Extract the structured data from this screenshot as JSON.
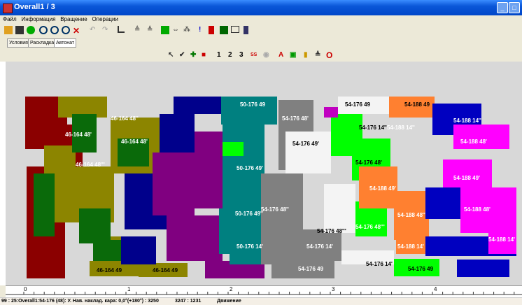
{
  "window": {
    "title": "Overall1 / 3",
    "minimize_glyph": "_",
    "maximize_glyph": "□"
  },
  "menu": {
    "items": [
      "Файл",
      "Информация",
      "Вращение",
      "Операции"
    ]
  },
  "tabs": [
    {
      "label": "Условия"
    },
    {
      "label": "Раскладка"
    },
    {
      "label": "Автонат"
    }
  ],
  "toolbar2": {
    "digits": [
      "1",
      "2",
      "3"
    ],
    "ss_label": "SS",
    "zero_label": "O"
  },
  "labels": {
    "p1": "46-164 48'",
    "p2": "46-164 48''",
    "p3": "46-164 48'",
    "p4": "46-164 48'''",
    "p5": "50-176 49",
    "p6": "50-176 49'",
    "p7": "50-176 49''",
    "p8": "50-176 14'",
    "p9": "54-176 48'",
    "p10": "54-176 49'",
    "p11": "54-176 49",
    "p12": "54-176 14''",
    "p13": "54-176 48''",
    "p14": "54-176 48'''",
    "p15": "54-176 14'",
    "p16": "54-176 49",
    "p17": "54-176 14'",
    "p18": "54-176 48'",
    "p19": "54-188 49",
    "p20": "54-188 14''",
    "p21": "54-188 48'",
    "p22": "54-188 49'",
    "p23": "54-188 14'",
    "p24": "54-188 48''",
    "p25": "54-188 14'",
    "p26": "54-188 49'",
    "p27": "54-188 48'",
    "p28": "54-188 14''",
    "p29": "54-176 49",
    "p30": "46-164 49",
    "p31": "46-164 49",
    "p32": "54-176 48'''"
  },
  "ruler": {
    "bottom_marks": [
      "0",
      "1",
      "2",
      "3",
      "4"
    ]
  },
  "status": {
    "left": "99 : 25:Overall1:54-176 (48): У. Нав. наклад. кара: 0,0°(+180°) : 3250",
    "coords": "3247 : 1231",
    "mode": "Движение"
  },
  "colors": {
    "titlebar": "#0a56d8",
    "canvas": "#d8d8d8",
    "dark_red": "#8b0000",
    "olive": "#8c8500",
    "blue": "#00008b",
    "purple": "#800080",
    "teal": "#008080",
    "grey": "#808080",
    "white": "#ffffff",
    "green": "#00ff00",
    "orange": "#ff8030",
    "magenta": "#ff00ff",
    "navy": "#0000c0"
  }
}
